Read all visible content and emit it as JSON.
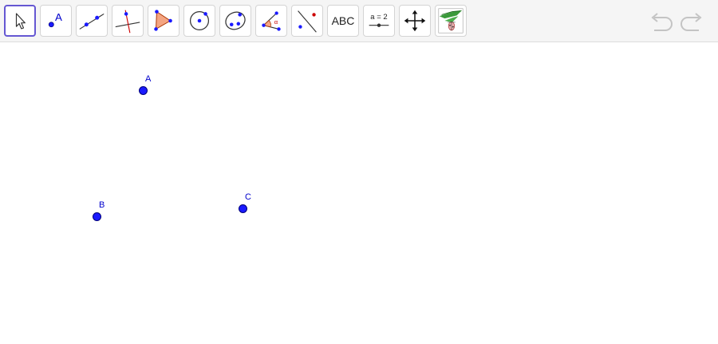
{
  "toolbar": {
    "tools": [
      {
        "name": "move",
        "label": ""
      },
      {
        "name": "point",
        "label": "A"
      },
      {
        "name": "line",
        "label": ""
      },
      {
        "name": "perpendicular",
        "label": ""
      },
      {
        "name": "polygon",
        "label": ""
      },
      {
        "name": "circle-center",
        "label": ""
      },
      {
        "name": "conic",
        "label": ""
      },
      {
        "name": "angle",
        "label": "α"
      },
      {
        "name": "reflect",
        "label": ""
      },
      {
        "name": "text",
        "label": "ABC"
      },
      {
        "name": "slider",
        "label": "a = 2"
      },
      {
        "name": "move-graphics",
        "label": ""
      },
      {
        "name": "custom",
        "label": ""
      }
    ],
    "selected": "move"
  },
  "points": [
    {
      "label": "A",
      "color": "#1a1aff"
    },
    {
      "label": "B",
      "color": "#1a1aff"
    },
    {
      "label": "C",
      "color": "#1a1aff"
    }
  ],
  "colors": {
    "accent": "#6557d2",
    "point": "#1a1aff",
    "label": "#0000cc",
    "polygon_fill": "#f4a582"
  }
}
